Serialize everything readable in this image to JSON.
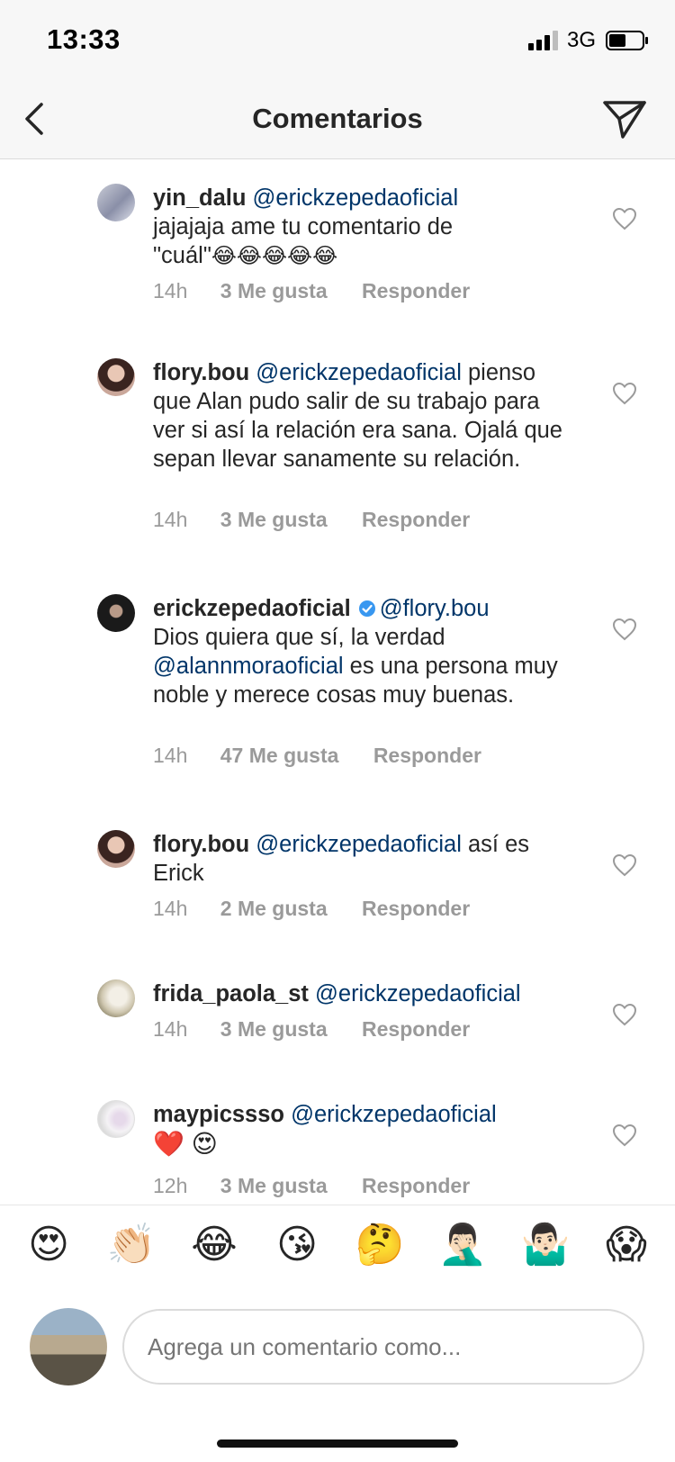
{
  "status_bar": {
    "time": "13:33",
    "network": "3G"
  },
  "header": {
    "title": "Comentarios"
  },
  "comments": [
    {
      "username": "yin_dalu",
      "mention": "@erickzepedaoficial",
      "text": "jajajaja ame tu comentario de",
      "text2": "\"cuál\"",
      "emojis": "😂😂😂😂😂",
      "time": "14h",
      "likes": "3 Me gusta",
      "reply": "Responder"
    },
    {
      "username": "flory.bou",
      "mention": "@erickzepedaoficial",
      "text": "pienso que Alan pudo salir de su trabajo para ver si así la relación era sana.  Ojalá que sepan llevar sanamente su relación.",
      "time": "14h",
      "likes": "3 Me gusta",
      "reply": "Responder"
    },
    {
      "username": "erickzepedaoficial",
      "verified": true,
      "mention": "@flory.bou",
      "text": "Dios quiera que sí, la verdad",
      "mention2": "@alannmoraoficial",
      "text2": "es una persona muy noble y merece cosas muy buenas.",
      "time": "14h",
      "likes": "47 Me gusta",
      "reply": "Responder"
    },
    {
      "username": "flory.bou",
      "mention": "@erickzepedaoficial",
      "text": "así es Erick",
      "time": "14h",
      "likes": "2 Me gusta",
      "reply": "Responder"
    },
    {
      "username": "frida_paola_st",
      "mention": "@erickzepedaoficial",
      "time": "14h",
      "likes": "3 Me gusta",
      "reply": "Responder"
    },
    {
      "username": "maypicssso",
      "mention": "@erickzepedaoficial",
      "emojis": "❤️ 😍",
      "time": "12h",
      "likes": "3 Me gusta",
      "reply": "Responder"
    }
  ],
  "emoji_bar": [
    "😍",
    "👏🏻",
    "😂",
    "😘",
    "🤔",
    "🤦🏻‍♂️",
    "🤷🏻‍♂️",
    "😱"
  ],
  "input": {
    "placeholder": "Agrega un comentario como..."
  },
  "colors": {
    "mention": "#003569",
    "meta": "#9a9a9a",
    "text": "#262626",
    "bar": "#f7f7f7"
  }
}
